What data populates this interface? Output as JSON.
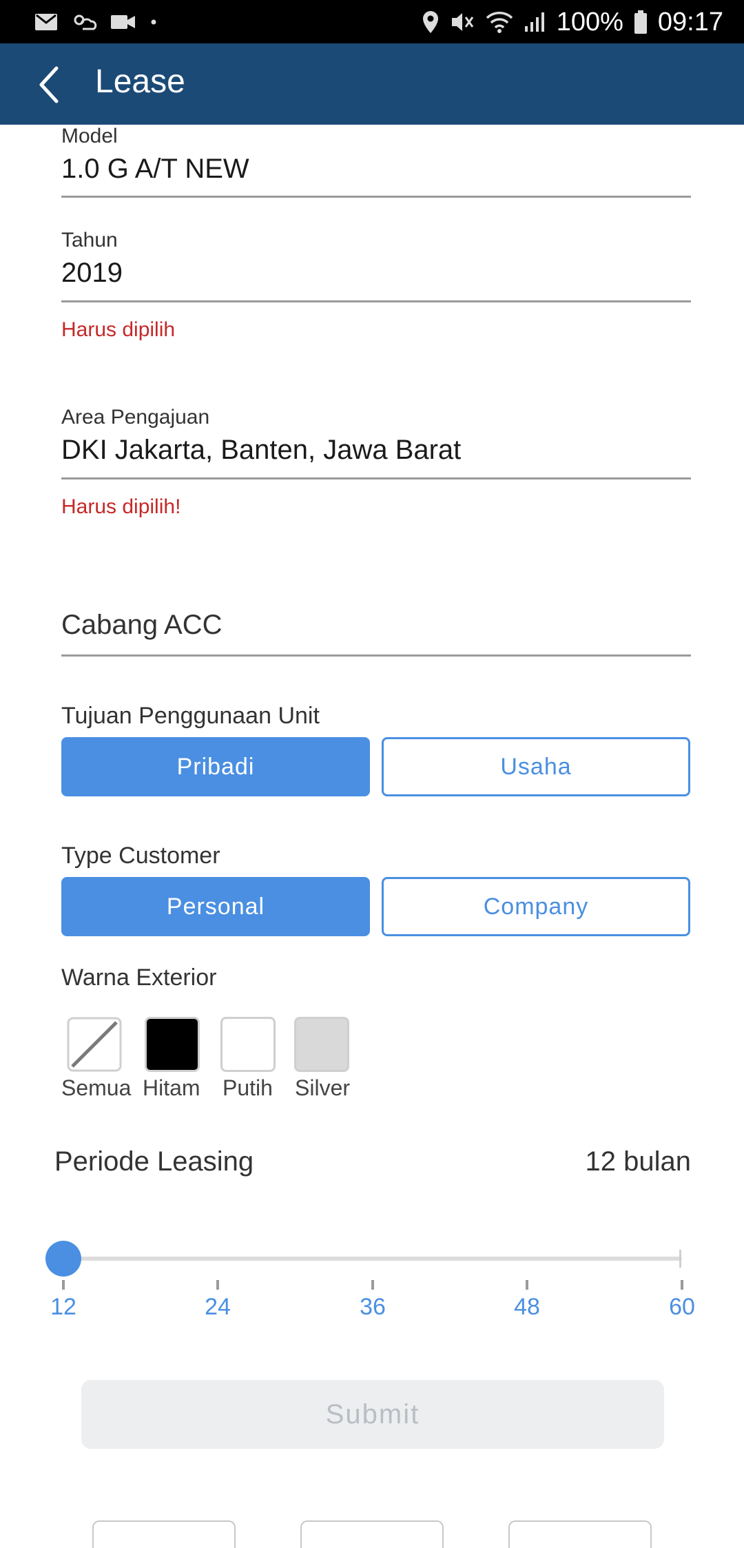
{
  "status_bar": {
    "icons_left": [
      "gmail-icon",
      "weather-icon",
      "video-icon",
      "dot-icon"
    ],
    "icons_right": [
      "location-icon",
      "mute-icon",
      "wifi-icon",
      "signal-icon",
      "battery-icon"
    ],
    "battery": "100%",
    "time": "09:17"
  },
  "appbar": {
    "title": "Lease",
    "back_icon": "chevron-left-icon"
  },
  "form": {
    "model": {
      "label": "Model",
      "value": "1.0 G A/T NEW"
    },
    "tahun": {
      "label": "Tahun",
      "value": "2019",
      "error": "Harus dipilih"
    },
    "area": {
      "label": "Area Pengajuan",
      "value": "DKI Jakarta, Banten, Jawa Barat",
      "error": "Harus dipilih!"
    },
    "cabang": {
      "placeholder": "Cabang ACC"
    },
    "tujuan": {
      "label": "Tujuan Penggunaan Unit",
      "options": [
        "Pribadi",
        "Usaha"
      ],
      "selected": "Pribadi"
    },
    "customer_type": {
      "label": "Type Customer",
      "options": [
        "Personal",
        "Company"
      ],
      "selected": "Personal"
    },
    "warna": {
      "label": "Warna Exterior",
      "options": [
        {
          "name": "Semua",
          "color": "none"
        },
        {
          "name": "Hitam",
          "color": "#000000"
        },
        {
          "name": "Putih",
          "color": "#ffffff"
        },
        {
          "name": "Silver",
          "color": "#d9d9d9"
        }
      ]
    },
    "periode": {
      "label": "Periode Leasing",
      "value_text": "12 bulan",
      "value": 12,
      "ticks": [
        "12",
        "24",
        "36",
        "48",
        "60"
      ]
    },
    "submit_label": "Submit"
  },
  "colors": {
    "appbar": "#1c4a76",
    "accent": "#4a8fe2",
    "error": "#c62828"
  }
}
